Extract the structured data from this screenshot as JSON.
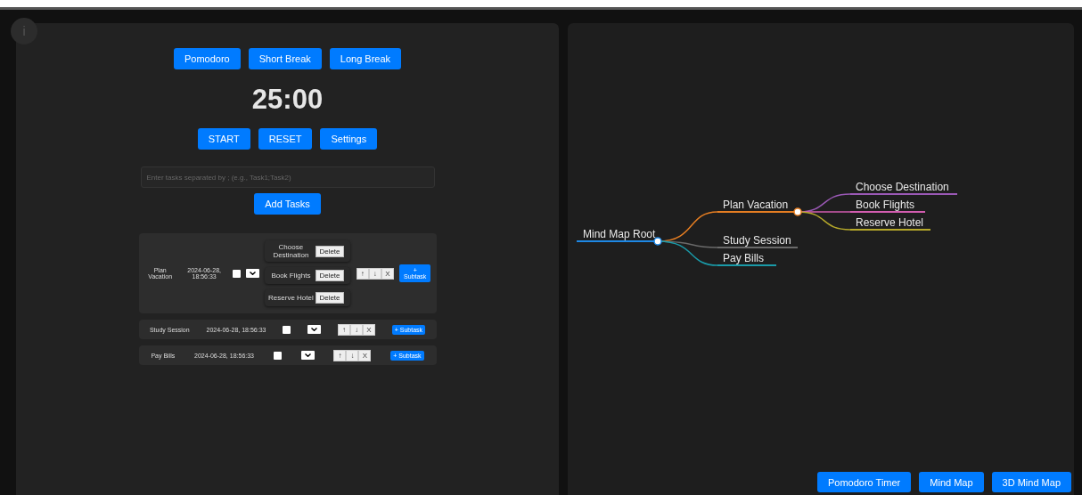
{
  "info_button": {
    "label": "i"
  },
  "timer": {
    "modes": [
      {
        "label": "Pomodoro"
      },
      {
        "label": "Short Break"
      },
      {
        "label": "Long Break"
      }
    ],
    "time": "25:00",
    "controls": [
      {
        "label": "START"
      },
      {
        "label": "RESET"
      },
      {
        "label": "Settings"
      }
    ]
  },
  "task_input": {
    "placeholder": "Enter tasks separated by ; (e.g., Task1;Task2)",
    "button": "Add Tasks"
  },
  "tasks": [
    {
      "name": "Plan Vacation",
      "created": "2024-06-28, 18:56:33",
      "checked": false,
      "move_up": "↑",
      "move_down": "↓",
      "remove": "X",
      "add_subtask": "+ Subtask",
      "subtasks": [
        {
          "name": "Choose Destination",
          "delete": "Delete"
        },
        {
          "name": "Book Flights",
          "delete": "Delete"
        },
        {
          "name": "Reserve Hotel",
          "delete": "Delete"
        }
      ]
    },
    {
      "name": "Study Session",
      "created": "2024-06-28, 18:56:33",
      "checked": false,
      "move_up": "↑",
      "move_down": "↓",
      "remove": "X",
      "add_subtask": "+ Subtask"
    },
    {
      "name": "Pay Bills",
      "created": "2024-06-28, 18:56:33",
      "checked": false,
      "move_up": "↑",
      "move_down": "↓",
      "remove": "X",
      "add_subtask": "+ Subtask"
    }
  ],
  "mind_map": {
    "root": {
      "label": "Mind Map Root",
      "color": "#1e88e5",
      "children": [
        {
          "label": "Plan Vacation",
          "color": "#e67e22",
          "children": [
            {
              "label": "Choose Destination",
              "color": "#9b59b6"
            },
            {
              "label": "Book Flights",
              "color": "#d35db0"
            },
            {
              "label": "Reserve Hotel",
              "color": "#b5a82a"
            }
          ]
        },
        {
          "label": "Study Session",
          "color": "#6a6a6a"
        },
        {
          "label": "Pay Bills",
          "color": "#1a9aa8"
        }
      ]
    }
  },
  "nav": [
    {
      "label": "Pomodoro Timer"
    },
    {
      "label": "Mind Map"
    },
    {
      "label": "3D Mind Map"
    }
  ]
}
